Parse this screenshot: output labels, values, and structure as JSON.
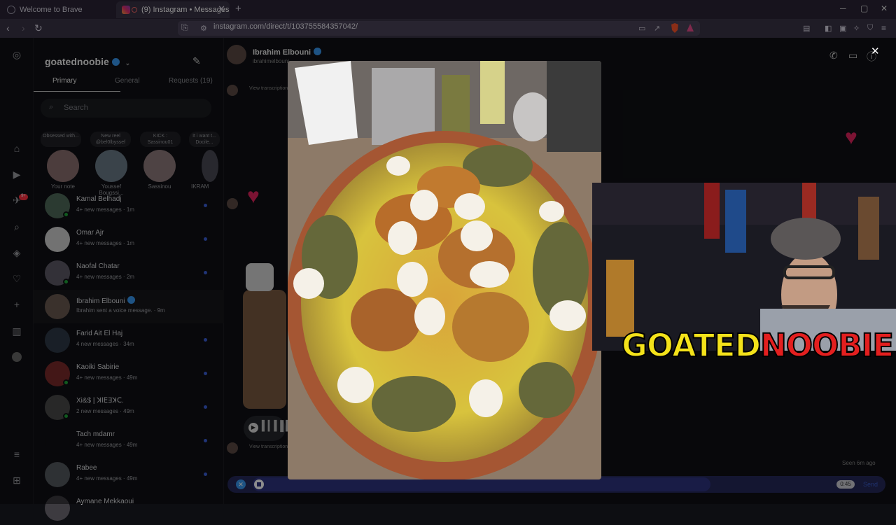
{
  "browser": {
    "tabs": [
      {
        "title": "Welcome to Brave"
      },
      {
        "title": "(9) Instagram • Messages"
      }
    ],
    "url": "instagram.com/direct/t/103755584357042/"
  },
  "inbox": {
    "username": "goatednoobie",
    "tabs": [
      "Primary",
      "General",
      "Requests (19)"
    ],
    "search_placeholder": "Search",
    "notes": [
      {
        "bubble": "Obsessed with...",
        "name": "Your note"
      },
      {
        "bubble": "New reel @bel0lbyssef",
        "name": "Youssef Bougssi..."
      },
      {
        "bubble": "KICK : Sassinou01",
        "name": "Sassinou"
      },
      {
        "bubble": "It i want t... Docile...",
        "name": "IKRAM"
      }
    ],
    "threads": [
      {
        "name": "Kamal Belhadj",
        "sub": "4+ new messages · 1m",
        "unread": true,
        "online": true
      },
      {
        "name": "Omar Ajr",
        "sub": "4+ new messages · 1m",
        "unread": true,
        "online": false
      },
      {
        "name": "Naofal Chatar",
        "sub": "4+ new messages · 2m",
        "unread": true,
        "online": true
      },
      {
        "name": "Ibrahim Elbouni",
        "sub": "Ibrahim sent a voice message. · 9m",
        "unread": false,
        "online": false
      },
      {
        "name": "Farid Ait El Haj",
        "sub": "4 new messages · 34m",
        "unread": true,
        "online": false
      },
      {
        "name": "Kaoiki Sabirie",
        "sub": "4+ new messages · 49m",
        "unread": true,
        "online": true
      },
      {
        "name": "Xi&$ | ꓘꓲꓰꓱꓘꓚ.",
        "sub": "2 new messages · 49m",
        "unread": true,
        "online": true
      },
      {
        "name": "Tach mdamr",
        "sub": "4+ new messages · 49m",
        "unread": true,
        "online": false
      },
      {
        "name": "Rabee",
        "sub": "4+ new messages · 49m",
        "unread": true,
        "online": false
      },
      {
        "name": "Aymane Mekkaoui",
        "sub": "",
        "unread": false,
        "online": false
      }
    ]
  },
  "chat": {
    "contact_name": "Ibrahim Elbouni",
    "contact_handle": "ibrahimelbouni",
    "transcript_label": "View transcription",
    "seen": "Seen 6m ago",
    "voice_time": "0:45",
    "send_label": "Send"
  },
  "overlay": {
    "brand_part1": "GOATED",
    "brand_part2": "NOOBIE"
  },
  "colors": {
    "accent": "#3897f0",
    "unread_dot": "#3b5fd9",
    "online": "#1fa53a",
    "heart": "#e0245e",
    "composer": "#2e3380"
  }
}
